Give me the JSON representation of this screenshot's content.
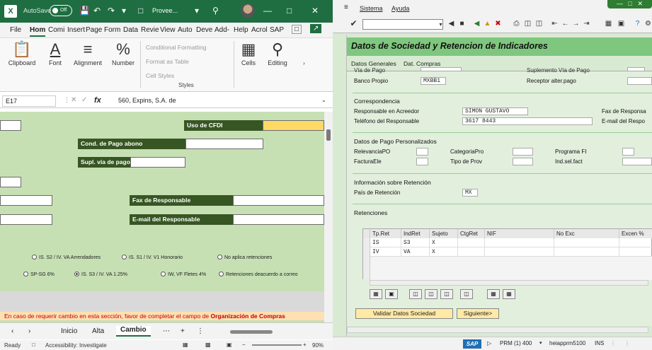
{
  "excel": {
    "autosave_label": "AutoSave",
    "autosave_state": "Off",
    "file_name": "Provee...",
    "ribbon_tabs": [
      "File",
      "Hom",
      "Comi",
      "Insert",
      "Page",
      "Form",
      "Data",
      "Revie",
      "View",
      "Auto",
      "Deve",
      "Add-",
      "Help",
      "Acrol",
      "SAP"
    ],
    "groups": {
      "clipboard": "Clipboard",
      "font": "Font",
      "alignment": "Alignment",
      "number": "Number",
      "styles": "Styles",
      "cells": "Cells",
      "editing": "Editing"
    },
    "styles_items": [
      "Conditional Formatting",
      "Format as Table",
      "Cell Styles"
    ],
    "name_box": "E17",
    "formula": "560, Expins, S.A. de",
    "form": {
      "uso_cfdi": "Uso de CFDI",
      "cond_pago": "Cond. de Pago abono",
      "supl_via": "Supl. vía de pago",
      "fax": "Fax de  Responsable",
      "email": "E-mail del  Responsable"
    },
    "radios": [
      {
        "label": "IS. S2 / IV. VA Arrendadores",
        "on": false
      },
      {
        "label": "IS. S1 / IV. V1 Honorario",
        "on": false
      },
      {
        "label": "No aplica retenciones",
        "on": false
      },
      {
        "label": "SP-SG 6%",
        "on": false
      },
      {
        "label": "IS. S3 / IV. VA 1.25%",
        "on": true
      },
      {
        "label": "IW, VF Fletes 4%",
        "on": false
      },
      {
        "label": "Retenciones deacuerdo a correo",
        "on": false
      }
    ],
    "note_text": "En caso de requerir cambio en esta sección, favor de completar el campo de ",
    "note_bold": "Organización de Compras",
    "sheet_tabs": [
      "Inicio",
      "Alta",
      "Cambio"
    ],
    "active_sheet": "Cambio",
    "status_ready": "Ready",
    "status_accessibility": "Accessibility: Investigate",
    "zoom": "90%"
  },
  "sap": {
    "menu": [
      "Sistema",
      "Ayuda"
    ],
    "title": "Datos de Sociedad y Retencion de Indicadores",
    "subtabs": [
      "Datos Generales",
      "Dat. Compras"
    ],
    "top_cut_left": "Vía de Pago",
    "top_cut_right": "Suplemento Vía de Pago",
    "banco_propio_label": "Banco Propio",
    "banco_propio_value": "MXBB1",
    "receptor_label": "Receptor alter.pago",
    "correspondencia_title": "Correspondencia",
    "resp_acreedor_label": "Responsable en Acreedor",
    "resp_acreedor_value": "SIMON GUSTAVO",
    "fax_label": "Fax de Responsa",
    "tel_label": "Teléfono del Responsable",
    "tel_value": "3617 8443",
    "email_label": "E-mail del Respo",
    "pago_title": "Datos de Pago Personalizados",
    "relevancia_label": "RelevanciaPO",
    "categoria_label": "CategoriaPro",
    "programa_label": "Programa FI",
    "factura_label": "FacturaEle",
    "tipo_prov_label": "Tipo de Prov",
    "indsel_label": "Ind.sel.fact",
    "info_ret_title": "Información sobre Retención",
    "pais_ret_label": "País de Retención",
    "pais_ret_value": "MX",
    "ret_title": "Retenciones",
    "table_headers": [
      "Tp.Ret",
      "IndRet",
      "Sujeto",
      "CtgRet",
      "NIF",
      "No Exc",
      "Excen %"
    ],
    "table_rows": [
      [
        "IS",
        "S3",
        "X",
        "",
        "",
        "",
        ""
      ],
      [
        "IV",
        "VA",
        "X",
        "",
        "",
        "",
        ""
      ]
    ],
    "validar_button": "Validar Datos Sociedad",
    "siguiente_button": "Siguiente>",
    "status_system": "PRM (1) 400",
    "status_server": "heiapprm5100",
    "status_mode": "INS"
  }
}
